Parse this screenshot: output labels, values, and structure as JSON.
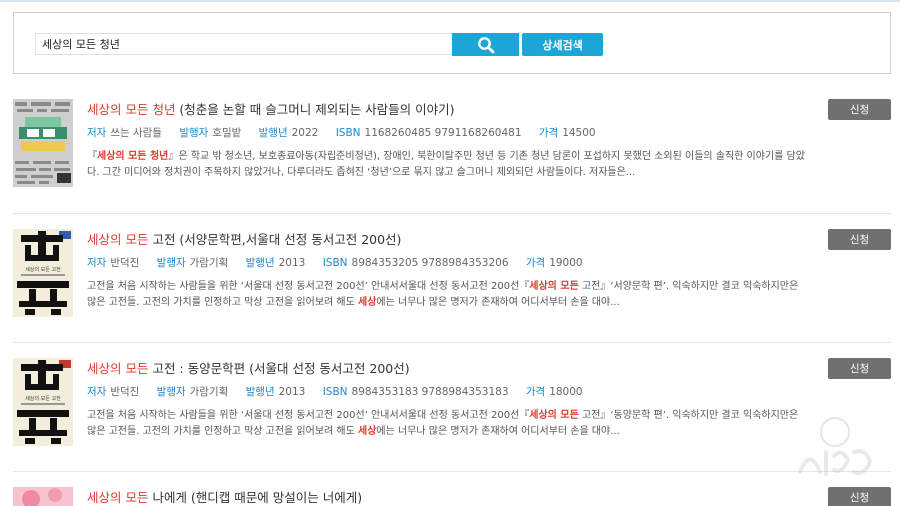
{
  "search": {
    "query": "세상의 모든 청년",
    "detail_label": "상세검색"
  },
  "labels": {
    "author": "저자",
    "publisher": "발행자",
    "year": "발행년",
    "isbn": "ISBN",
    "price": "가격",
    "apply": "신청"
  },
  "results": [
    {
      "title_hl": "세상의 모든 청년",
      "title_rest": " (청춘을 논할 때 슬그머니 제외되는 사람들의 이야기)",
      "author": "쓰는 사람들",
      "publisher": "호밀밭",
      "year": "2022",
      "isbn": "1168260485 9791168260481",
      "price": "14500",
      "desc_pre": "『",
      "desc_hl": "세상의 모든 청년",
      "desc_mid": "』은 학교 밖 청소년, 보호종료아동(자립준비청년), 장애인, 북한이탈주민 청년 등 기존 청년 담론이 포섭하지 못했던 소외된 이들의 솔직한 이야기를 담았다. 그간 미디어와 정치권이 주목하지 않았거나, 다루더라도 좁혀진 ‘청년’으로 묶지 않고 슬그머니 제외되던 사람들이다. 저자들은...",
      "desc_hl2": "",
      "desc_post": ""
    },
    {
      "title_hl": "세상의 모든",
      "title_rest": " 고전 (서양문학편,서울대 선정 동서고전 200선)",
      "author": "반덕진",
      "publisher": "가람기획",
      "year": "2013",
      "isbn": "8984353205 9788984353206",
      "price": "19000",
      "desc_pre": "고전을 처음 시작하는 사람들을 위한 ‘서울대 선정 동서고전 200선’ 안내서서울대 선정 동서고전 200선『",
      "desc_hl": "세상의 모든",
      "desc_mid": " 고전』‘서양문학 편’. 익숙하지만 결코 익숙하지만은 않은 고전들. 고전의 가치를 인정하고 막상 고전을 읽어보려 해도 ",
      "desc_hl2": "세상",
      "desc_post": "에는 너무나 많은 명저가 존재하여 어디서부터 손을 대야..."
    },
    {
      "title_hl": "세상의 모든",
      "title_rest": " 고전 : 동양문학편 (서울대 선정 동서고전 200선)",
      "author": "반덕진",
      "publisher": "가람기획",
      "year": "2013",
      "isbn": "8984353183 9788984353183",
      "price": "18000",
      "desc_pre": "고전을 처음 시작하는 사람들을 위한 ‘서울대 선정 동서고전 200선’ 안내서서울대 선정 동서고전 200선『",
      "desc_hl": "세상의 모든",
      "desc_mid": " 고전』‘동양문학 편’. 익숙하지만 결코 익숙하지만은 않은 고전들. 고전의 가치를 인정하고 막상 고전을 읽어보려 해도 ",
      "desc_hl2": "세상",
      "desc_post": "에는 너무나 많은 명저가 존재하여 어디서부터 손을 대야..."
    },
    {
      "title_hl": "세상의 모든",
      "title_rest": " 나에게 (핸디캡 때문에 망설이는 너에게)"
    }
  ],
  "cover_texts": {
    "cover2": "세상의 모든 고전",
    "cover3": "세상의 모든 고전"
  },
  "colors": {
    "accent": "#1ea5d8",
    "highlight": "#e0382f",
    "label": "#1a88c9",
    "apply_button": "#707070"
  }
}
